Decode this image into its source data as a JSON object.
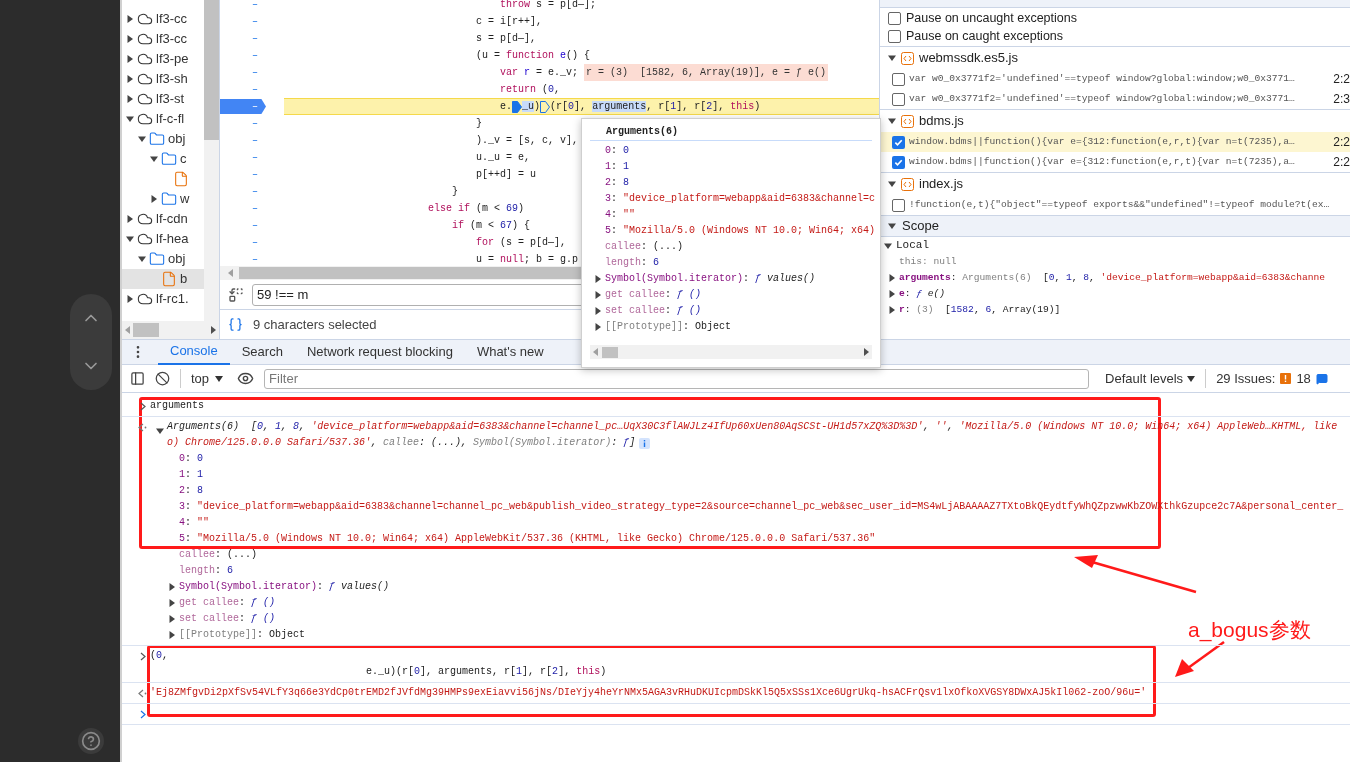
{
  "file_tree": [
    {
      "label": "lf3-cc",
      "kind": "domain",
      "expanded": false,
      "selected": false
    },
    {
      "label": "lf3-cc",
      "kind": "domain",
      "expanded": false,
      "selected": false
    },
    {
      "label": "lf3-pe",
      "kind": "domain",
      "expanded": false,
      "selected": false
    },
    {
      "label": "lf3-sh",
      "kind": "domain",
      "expanded": false,
      "selected": false
    },
    {
      "label": "lf3-st",
      "kind": "domain",
      "expanded": false,
      "selected": false
    },
    {
      "label": "lf-c-fl",
      "kind": "domain",
      "expanded": true,
      "selected": false,
      "children": [
        {
          "label": "obj",
          "kind": "folder",
          "expanded": true,
          "selected": false,
          "children": [
            {
              "label": "c",
              "kind": "folder",
              "expanded": true,
              "selected": false,
              "children": [
                {
                  "kind": "file",
                  "selected": false
                }
              ]
            },
            {
              "label": "w",
              "kind": "folder",
              "expanded": false,
              "selected": false
            }
          ]
        }
      ]
    },
    {
      "label": "lf-cdn",
      "kind": "domain",
      "expanded": false,
      "selected": false
    },
    {
      "label": "lf-hea",
      "kind": "domain",
      "expanded": true,
      "selected": false,
      "children": [
        {
          "label": "obj",
          "kind": "folder",
          "expanded": true,
          "selected": false,
          "children": [
            {
              "label": "b",
              "kind": "file",
              "selected": true
            }
          ]
        }
      ]
    },
    {
      "label": "lf-rc1.",
      "kind": "domain",
      "expanded": false,
      "selected": false
    }
  ],
  "editor": {
    "lines": [
      {
        "gutter": "–",
        "breakpoint": false,
        "current": false,
        "tokens": [
          {
            "text": "                                    throw",
            "kind": "kw"
          },
          {
            "text": " s = p[d—];",
            "kind": "plain"
          }
        ]
      },
      {
        "gutter": "–",
        "breakpoint": false,
        "current": false,
        "tokens": [
          {
            "text": "                                c = i[r++],",
            "kind": "plain"
          }
        ]
      },
      {
        "gutter": "–",
        "breakpoint": false,
        "current": false,
        "tokens": [
          {
            "text": "                                s = p[d—],",
            "kind": "plain"
          }
        ]
      },
      {
        "gutter": "–",
        "breakpoint": false,
        "current": false,
        "tokens": [
          {
            "text": "                                (u = ",
            "kind": "plain"
          },
          {
            "text": "function",
            "kind": "kw"
          },
          {
            "text": " e",
            "kind": "def"
          },
          {
            "text": "() {",
            "kind": "plain"
          }
        ]
      },
      {
        "gutter": "–",
        "breakpoint": false,
        "current": false,
        "tokens": [
          {
            "text": "                                    var",
            "kind": "kw"
          },
          {
            "text": " r",
            "kind": "def"
          },
          {
            "text": " = e._v;",
            "kind": "plain"
          }
        ],
        "inline_value": "r = (3)  [1582, 6, Array(19)], e = ƒ e()"
      },
      {
        "gutter": "–",
        "breakpoint": false,
        "current": false,
        "tokens": [
          {
            "text": "                                    return",
            "kind": "kw"
          },
          {
            "text": " (",
            "kind": "plain"
          },
          {
            "text": "0",
            "kind": "num"
          },
          {
            "text": ",",
            "kind": "plain"
          }
        ]
      },
      {
        "gutter": "–",
        "breakpoint": true,
        "current": true,
        "tokens": [
          {
            "text": "                                    e.",
            "kind": "plain"
          },
          {
            "kind": "mark",
            "filled": true
          },
          {
            "text": "_u",
            "kind": "hl"
          },
          {
            "text": ")",
            "kind": "plain"
          },
          {
            "kind": "mark",
            "filled": false
          },
          {
            "text": "(r[",
            "kind": "plain"
          },
          {
            "text": "0",
            "kind": "num"
          },
          {
            "text": "], ",
            "kind": "plain"
          },
          {
            "text": "arguments",
            "kind": "sel"
          },
          {
            "text": ", r[",
            "kind": "plain"
          },
          {
            "text": "1",
            "kind": "num"
          },
          {
            "text": "], r[",
            "kind": "plain"
          },
          {
            "text": "2",
            "kind": "num"
          },
          {
            "text": "], ",
            "kind": "plain"
          },
          {
            "text": "this",
            "kind": "kw"
          },
          {
            "text": ")",
            "kind": "plain"
          }
        ]
      },
      {
        "gutter": "–",
        "breakpoint": false,
        "current": false,
        "tokens": [
          {
            "text": "                                }",
            "kind": "plain"
          }
        ]
      },
      {
        "gutter": "–",
        "breakpoint": false,
        "current": false,
        "tokens": [
          {
            "text": "                                )._v = [s, c, v],",
            "kind": "plain"
          }
        ]
      },
      {
        "gutter": "–",
        "breakpoint": false,
        "current": false,
        "tokens": [
          {
            "text": "                                u._u = e,",
            "kind": "plain"
          }
        ]
      },
      {
        "gutter": "–",
        "breakpoint": false,
        "current": false,
        "tokens": [
          {
            "text": "                                p[++d] = u",
            "kind": "plain"
          }
        ]
      },
      {
        "gutter": "–",
        "breakpoint": false,
        "current": false,
        "tokens": [
          {
            "text": "                            }",
            "kind": "plain"
          }
        ]
      },
      {
        "gutter": "–",
        "breakpoint": false,
        "current": false,
        "tokens": [
          {
            "text": "                        else if",
            "kind": "kw"
          },
          {
            "text": " (m < ",
            "kind": "plain"
          },
          {
            "text": "69",
            "kind": "num"
          },
          {
            "text": ")",
            "kind": "plain"
          }
        ]
      },
      {
        "gutter": "–",
        "breakpoint": false,
        "current": false,
        "tokens": [
          {
            "text": "                            if",
            "kind": "kw"
          },
          {
            "text": " (m < ",
            "kind": "plain"
          },
          {
            "text": "67",
            "kind": "num"
          },
          {
            "text": ") {",
            "kind": "plain"
          }
        ]
      },
      {
        "gutter": "–",
        "breakpoint": false,
        "current": false,
        "tokens": [
          {
            "text": "                                for",
            "kind": "kw"
          },
          {
            "text": " (s = p[d—],",
            "kind": "plain"
          }
        ]
      },
      {
        "gutter": "–",
        "breakpoint": false,
        "current": false,
        "tokens": [
          {
            "text": "                                u = ",
            "kind": "plain"
          },
          {
            "text": "null",
            "kind": "kw"
          },
          {
            "text": "; b = g.p",
            "kind": "plain"
          }
        ]
      }
    ],
    "search": {
      "value": "59 !== m"
    },
    "status": "9 characters selected"
  },
  "popover": {
    "title": "Arguments(6)",
    "rows": [
      {
        "tokens": [
          {
            "text": "0",
            "kind": "key"
          },
          {
            "text": ": ",
            "kind": "plain"
          },
          {
            "text": "0",
            "kind": "num"
          }
        ]
      },
      {
        "tokens": [
          {
            "text": "1",
            "kind": "key"
          },
          {
            "text": ": ",
            "kind": "plain"
          },
          {
            "text": "1",
            "kind": "num"
          }
        ]
      },
      {
        "tokens": [
          {
            "text": "2",
            "kind": "key"
          },
          {
            "text": ": ",
            "kind": "plain"
          },
          {
            "text": "8",
            "kind": "num"
          }
        ]
      },
      {
        "tokens": [
          {
            "text": "3",
            "kind": "key"
          },
          {
            "text": ": ",
            "kind": "plain"
          },
          {
            "text": "\"device_platform=webapp&aid=6383&channel=c",
            "kind": "str"
          }
        ]
      },
      {
        "tokens": [
          {
            "text": "4",
            "kind": "key"
          },
          {
            "text": ": ",
            "kind": "plain"
          },
          {
            "text": "\"\"",
            "kind": "str"
          }
        ]
      },
      {
        "tokens": [
          {
            "text": "5",
            "kind": "key"
          },
          {
            "text": ": ",
            "kind": "plain"
          },
          {
            "text": "\"Mozilla/5.0 (Windows NT 10.0; Win64; x64)",
            "kind": "str"
          }
        ]
      },
      {
        "tokens": [
          {
            "text": "callee",
            "kind": "dkey"
          },
          {
            "text": ": (...)",
            "kind": "plain"
          }
        ]
      },
      {
        "tokens": [
          {
            "text": "length",
            "kind": "dkey"
          },
          {
            "text": ": ",
            "kind": "plain"
          },
          {
            "text": "6",
            "kind": "num"
          }
        ]
      },
      {
        "expandable": true,
        "expanded": false,
        "tokens": [
          {
            "text": "Symbol(Symbol.iterator)",
            "kind": "key"
          },
          {
            "text": ": ",
            "kind": "plain"
          },
          {
            "text": "ƒ ",
            "kind": "fsym"
          },
          {
            "text": "values()",
            "kind": "fn"
          }
        ]
      },
      {
        "expandable": true,
        "expanded": false,
        "tokens": [
          {
            "text": "get callee",
            "kind": "dkey"
          },
          {
            "text": ": ",
            "kind": "plain"
          },
          {
            "text": "ƒ ()",
            "kind": "fsym"
          }
        ]
      },
      {
        "expandable": true,
        "expanded": false,
        "tokens": [
          {
            "text": "set callee",
            "kind": "dkey"
          },
          {
            "text": ": ",
            "kind": "plain"
          },
          {
            "text": "ƒ ()",
            "kind": "fsym"
          }
        ]
      },
      {
        "expandable": true,
        "expanded": false,
        "tokens": [
          {
            "text": "[[Prototype]]",
            "kind": "gray"
          },
          {
            "text": ": Object",
            "kind": "plain"
          }
        ]
      }
    ]
  },
  "pause_options": [
    {
      "label": "Pause on uncaught exceptions",
      "checked": false
    },
    {
      "label": "Pause on caught exceptions",
      "checked": false
    }
  ],
  "breakpoints": [
    {
      "file": "webmssdk.es5.js",
      "expanded": true,
      "items": [
        {
          "checked": false,
          "selected": false,
          "code": "var w0_0x3771f2='undefined'==typeof window?global:window;w0_0x3771…",
          "location": "2:2"
        },
        {
          "checked": false,
          "selected": false,
          "code": "var w0_0x3771f2='undefined'==typeof window?global:window;w0_0x3771…",
          "location": "2:3"
        }
      ]
    },
    {
      "file": "bdms.js",
      "expanded": true,
      "items": [
        {
          "checked": true,
          "selected": true,
          "code": "window.bdms||function(){var e={312:function(e,r,t){var n=t(7235),a…",
          "location": "2:2"
        },
        {
          "checked": true,
          "selected": false,
          "code": "window.bdms||function(){var e={312:function(e,r,t){var n=t(7235),a…",
          "location": "2:2"
        }
      ]
    },
    {
      "file": "index.js",
      "expanded": true,
      "items": [
        {
          "checked": false,
          "selected": false,
          "code": "!function(e,t){\"object\"==typeof exports&&\"undefined\"!=typeof module?t(ex…"
        }
      ]
    }
  ],
  "scope": {
    "title": "Scope",
    "expanded": true,
    "sections": [
      {
        "title": "Local",
        "expanded": true,
        "vars": [
          {
            "tokens": [
              {
                "text": "this",
                "kind": "gray"
              },
              {
                "text": ": null",
                "kind": "gray"
              }
            ]
          },
          {
            "expandable": true,
            "expanded": false,
            "tokens": [
              {
                "text": "arguments",
                "kind": "keyb"
              },
              {
                "text": ": ",
                "kind": "plain"
              },
              {
                "text": "Arguments(6)",
                "kind": "gray"
              },
              {
                "text": "  [",
                "kind": "plain"
              },
              {
                "text": "0",
                "kind": "num"
              },
              {
                "text": ", ",
                "kind": "plain"
              },
              {
                "text": "1",
                "kind": "num"
              },
              {
                "text": ", ",
                "kind": "plain"
              },
              {
                "text": "8",
                "kind": "num"
              },
              {
                "text": ", ",
                "kind": "plain"
              },
              {
                "text": "'device_platform=webapp&aid=6383&channe",
                "kind": "str"
              }
            ]
          },
          {
            "expandable": true,
            "expanded": false,
            "tokens": [
              {
                "text": "e",
                "kind": "keyb"
              },
              {
                "text": ": ",
                "kind": "plain"
              },
              {
                "text": "ƒ ",
                "kind": "fsym"
              },
              {
                "text": "e()",
                "kind": "fn"
              }
            ]
          },
          {
            "expandable": true,
            "expanded": false,
            "tokens": [
              {
                "text": "r",
                "kind": "keyb"
              },
              {
                "text": ": ",
                "kind": "plain"
              },
              {
                "text": "(3)",
                "kind": "gray"
              },
              {
                "text": "  [",
                "kind": "plain"
              },
              {
                "text": "1582",
                "kind": "num"
              },
              {
                "text": ", ",
                "kind": "plain"
              },
              {
                "text": "6",
                "kind": "num"
              },
              {
                "text": ", Array(19)]",
                "kind": "plain"
              }
            ]
          }
        ]
      }
    ]
  },
  "drawer_tabs": [
    {
      "label": "Console",
      "selected": true
    },
    {
      "label": "Search",
      "selected": false
    },
    {
      "label": "Network request blocking",
      "selected": false
    },
    {
      "label": "What's new",
      "selected": false
    }
  ],
  "console_toolbar": {
    "context": "top",
    "filter_placeholder": "Filter",
    "levels": "Default levels",
    "issues_label": "29 Issues:",
    "warning_count": "18"
  },
  "console": [
    {
      "kind": "input",
      "lines": [
        [
          {
            "text": "arguments",
            "kind": "plain"
          }
        ]
      ]
    },
    {
      "kind": "output",
      "expandable": true,
      "expanded": true,
      "info": true,
      "lines": [
        [
          {
            "text": "Arguments(6)",
            "kind": "iplain"
          },
          {
            "text": "  [",
            "kind": "iplain"
          },
          {
            "text": "0",
            "kind": "inum"
          },
          {
            "text": ", ",
            "kind": "iplain"
          },
          {
            "text": "1",
            "kind": "inum"
          },
          {
            "text": ", ",
            "kind": "iplain"
          },
          {
            "text": "8",
            "kind": "inum"
          },
          {
            "text": ", ",
            "kind": "iplain"
          },
          {
            "text": "'device_platform=webapp&aid=6383&channel=channel_pc…UqX30C3flAWJLz4IfUp60xUen80AqSCSt-UH1d57xZQ%3D%3D'",
            "kind": "istr"
          },
          {
            "text": ", ",
            "kind": "iplain"
          },
          {
            "text": "''",
            "kind": "istr"
          },
          {
            "text": ", ",
            "kind": "iplain"
          },
          {
            "text": "'Mozilla/5.0 (Windows NT 10.0; Win64; x64) AppleWeb…KHTML, like",
            "kind": "istr"
          }
        ],
        [
          {
            "text": "o) Chrome/125.0.0.0 Safari/537.36'",
            "kind": "istr"
          },
          {
            "text": ", ",
            "kind": "iplain"
          },
          {
            "text": "callee",
            "kind": "igray"
          },
          {
            "text": ": (...)",
            "kind": "iplain"
          },
          {
            "text": ", ",
            "kind": "iplain"
          },
          {
            "text": "Symbol(Symbol.iterator)",
            "kind": "igray"
          },
          {
            "text": ": ",
            "kind": "iplain"
          },
          {
            "text": "ƒ",
            "kind": "fsym"
          },
          {
            "text": "]",
            "kind": "iplain"
          }
        ]
      ],
      "children": [
        {
          "tokens": [
            {
              "text": "0",
              "kind": "key"
            },
            {
              "text": ": ",
              "kind": "plain"
            },
            {
              "text": "0",
              "kind": "num"
            }
          ]
        },
        {
          "tokens": [
            {
              "text": "1",
              "kind": "key"
            },
            {
              "text": ": ",
              "kind": "plain"
            },
            {
              "text": "1",
              "kind": "num"
            }
          ]
        },
        {
          "tokens": [
            {
              "text": "2",
              "kind": "key"
            },
            {
              "text": ": ",
              "kind": "plain"
            },
            {
              "text": "8",
              "kind": "num"
            }
          ]
        },
        {
          "tokens": [
            {
              "text": "3",
              "kind": "key"
            },
            {
              "text": ": ",
              "kind": "plain"
            },
            {
              "text": "\"device_platform=webapp&aid=6383&channel=channel_pc_web&publish_video_strategy_type=2&source=channel_pc_web&sec_user_id=MS4wLjABAAAAZ7TXtoBkQEydtfyWhQZpzwwKbZOWXthkGzupce2c7A&personal_center_",
              "kind": "str"
            }
          ]
        },
        {
          "tokens": [
            {
              "text": "4",
              "kind": "key"
            },
            {
              "text": ": ",
              "kind": "plain"
            },
            {
              "text": "\"\"",
              "kind": "str"
            }
          ]
        },
        {
          "tokens": [
            {
              "text": "5",
              "kind": "key"
            },
            {
              "text": ": ",
              "kind": "plain"
            },
            {
              "text": "\"Mozilla/5.0 (Windows NT 10.0; Win64; x64) AppleWebKit/537.36 (KHTML, like Gecko) Chrome/125.0.0.0 Safari/537.36\"",
              "kind": "str"
            }
          ]
        },
        {
          "tokens": [
            {
              "text": "callee",
              "kind": "dkey"
            },
            {
              "text": ": (...)",
              "kind": "plain"
            }
          ]
        },
        {
          "tokens": [
            {
              "text": "length",
              "kind": "dkey"
            },
            {
              "text": ": ",
              "kind": "plain"
            },
            {
              "text": "6",
              "kind": "num"
            }
          ]
        },
        {
          "expandable": true,
          "expanded": false,
          "tokens": [
            {
              "text": "Symbol(Symbol.iterator)",
              "kind": "key"
            },
            {
              "text": ": ",
              "kind": "plain"
            },
            {
              "text": "ƒ ",
              "kind": "fsym"
            },
            {
              "text": "values()",
              "kind": "fn"
            }
          ]
        },
        {
          "expandable": true,
          "expanded": false,
          "tokens": [
            {
              "text": "get callee",
              "kind": "dkey"
            },
            {
              "text": ": ",
              "kind": "plain"
            },
            {
              "text": "ƒ ()",
              "kind": "fsym"
            }
          ]
        },
        {
          "expandable": true,
          "expanded": false,
          "tokens": [
            {
              "text": "set callee",
              "kind": "dkey"
            },
            {
              "text": ": ",
              "kind": "plain"
            },
            {
              "text": "ƒ ()",
              "kind": "fsym"
            }
          ]
        },
        {
          "expandable": true,
          "expanded": false,
          "tokens": [
            {
              "text": "[[Prototype]]",
              "kind": "gray"
            },
            {
              "text": ": Object",
              "kind": "plain"
            }
          ]
        }
      ]
    },
    {
      "kind": "input",
      "lines": [
        [
          {
            "text": "(",
            "kind": "plain"
          },
          {
            "text": "0",
            "kind": "num"
          },
          {
            "text": ",",
            "kind": "plain"
          }
        ],
        [
          {
            "text": "                                    e._u)(r[",
            "kind": "plain"
          },
          {
            "text": "0",
            "kind": "num"
          },
          {
            "text": "], arguments, r[",
            "kind": "plain"
          },
          {
            "text": "1",
            "kind": "num"
          },
          {
            "text": "], r[",
            "kind": "plain"
          },
          {
            "text": "2",
            "kind": "num"
          },
          {
            "text": "], ",
            "kind": "plain"
          },
          {
            "text": "this",
            "kind": "kw"
          },
          {
            "text": ")",
            "kind": "plain"
          }
        ]
      ]
    },
    {
      "kind": "output",
      "lines": [
        [
          {
            "text": "'Ej8ZMfgvDi2pXfSv54VLfY3q66e3YdCp0trEMD2fJVfdMg39HMPs9exEiavvi56jNs/DIeYjy4heYrNMx5AGA3vRHuDKUIcpmDSkKl5Q5xSSs1Xce6UgrUkq-hsACFrQsv1lxOfkoXVGSY8DWxAJ5kIl062-zoO/96u='",
            "kind": "str"
          }
        ]
      ]
    },
    {
      "kind": "prompt"
    }
  ],
  "annotation": {
    "label": "a_bogus参数"
  }
}
